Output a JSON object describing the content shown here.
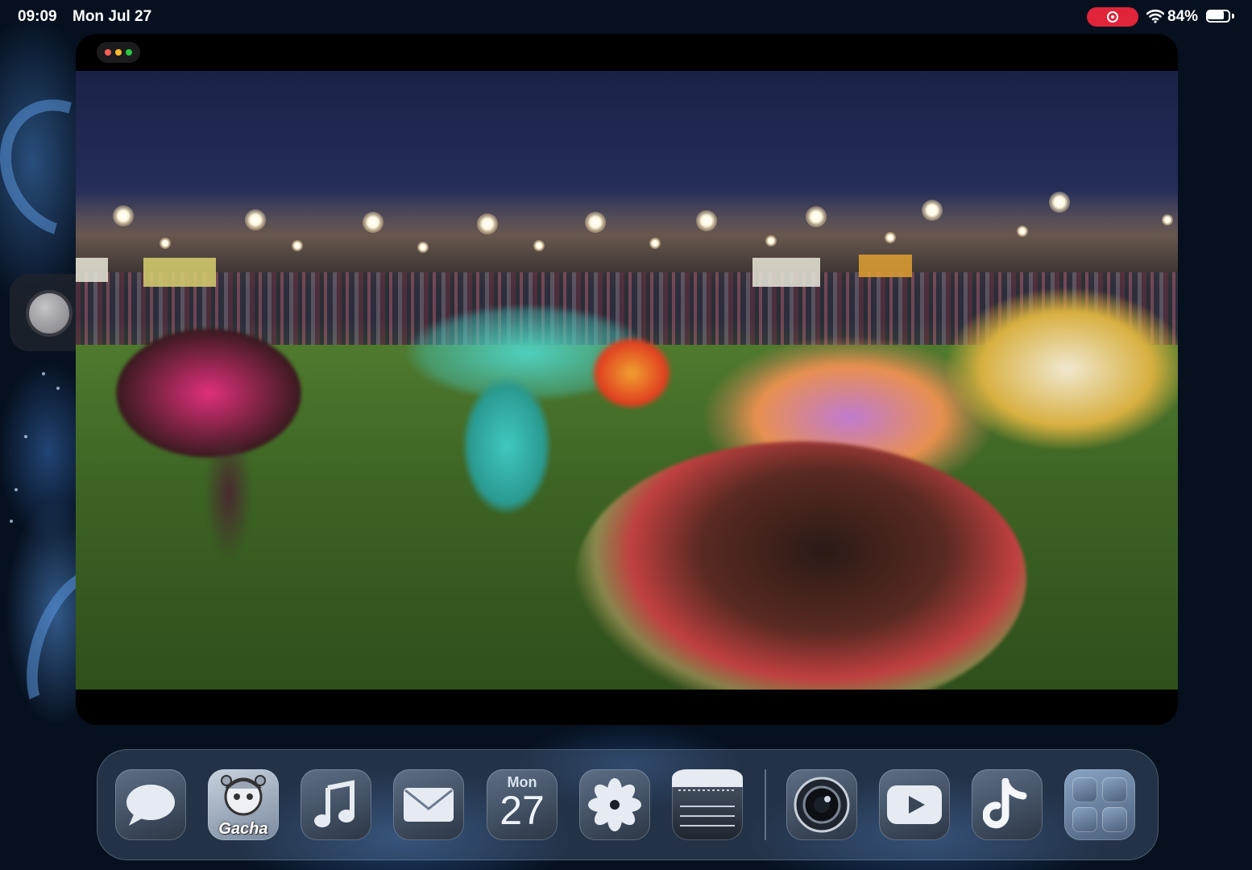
{
  "status_bar": {
    "time": "09:09",
    "date": "Mon Jul 27",
    "battery_percent": "84%",
    "battery_level": 0.84,
    "recording_color": "#e0243a",
    "icons": [
      "screen-recording-icon",
      "wifi-icon",
      "battery-icon"
    ]
  },
  "window": {
    "controls": [
      "window-options-icon"
    ],
    "dot_colors": [
      "#ff5f57",
      "#febc2e",
      "#28c840"
    ],
    "content": "video-player"
  },
  "dock": {
    "apps": [
      {
        "name": "Messages",
        "icon": "messages-icon"
      },
      {
        "name": "Gacha",
        "icon": "gacha-icon",
        "label": "Gacha"
      },
      {
        "name": "Music",
        "icon": "music-note-icon"
      },
      {
        "name": "Mail",
        "icon": "mail-icon"
      },
      {
        "name": "Calendar",
        "icon": "calendar-icon",
        "day": "Mon",
        "date": "27"
      },
      {
        "name": "Photos",
        "icon": "photos-flower-icon"
      },
      {
        "name": "Notes",
        "icon": "notes-icon"
      },
      {
        "name": "Camera",
        "icon": "camera-icon"
      },
      {
        "name": "YouTube",
        "icon": "youtube-play-icon"
      },
      {
        "name": "TikTok",
        "icon": "tiktok-icon"
      },
      {
        "name": "App Folder",
        "icon": "app-folder-icon"
      }
    ]
  }
}
